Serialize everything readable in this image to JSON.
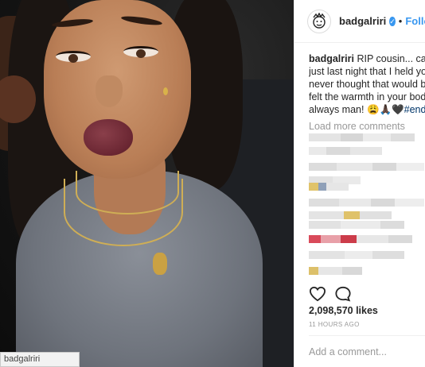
{
  "post": {
    "username": "badgalriri",
    "follow_label": "Follow",
    "separator": "•",
    "caption_lines": [
      "RIP cousin... can't be",
      "just last night that I held you in",
      "never thought that would be the",
      "felt the warmth in your body!!!",
      "always man! "
    ],
    "caption_emoji": "😩🙏🏿🖤",
    "caption_hashtag": "#endgun",
    "load_more": "Load more comments",
    "likes": "2,098,570 likes",
    "time": "11 HOURS AGO",
    "add_comment_placeholder": "Add a comment..."
  },
  "photo": {
    "caption_tab": "badgalriri"
  },
  "colors": {
    "accent": "#3897f0",
    "hashtag": "#003569",
    "muted": "#999999"
  },
  "icons": [
    "verified-badge-icon",
    "heart-icon",
    "comment-icon",
    "avatar-logo-icon"
  ]
}
